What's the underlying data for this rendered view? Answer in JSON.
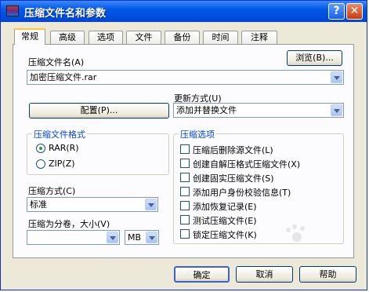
{
  "window": {
    "title": "压缩文件名和参数",
    "help_glyph": "?",
    "close_glyph": "✕"
  },
  "tabs": [
    "常规",
    "高级",
    "选项",
    "文件",
    "备份",
    "时间",
    "注释"
  ],
  "archive_name": {
    "label": "压缩文件名(A)",
    "value": "加密压缩文件.rar",
    "browse_button": "浏览(B)..."
  },
  "profiles_button": "配置(P)...",
  "update_mode": {
    "label": "更新方式(U)",
    "value": "添加并替换文件"
  },
  "format_group": {
    "title": "压缩文件格式",
    "options": [
      "RAR(R)",
      "ZIP(Z)"
    ],
    "selected": "RAR(R)"
  },
  "options_group": {
    "title": "压缩选项",
    "items": [
      {
        "label": "压缩后删除源文件(L)",
        "checked": false
      },
      {
        "label": "创建自解压格式压缩文件(X)",
        "checked": false
      },
      {
        "label": "创建固实压缩文件(S)",
        "checked": false
      },
      {
        "label": "添加用户身份校验信息(T)",
        "checked": false
      },
      {
        "label": "添加恢复记录(E)",
        "checked": false
      },
      {
        "label": "测试压缩文件(E)",
        "checked": false
      },
      {
        "label": "锁定压缩文件(K)",
        "checked": false
      }
    ]
  },
  "compression_method": {
    "label": "压缩方式(C)",
    "value": "标准"
  },
  "split_volumes": {
    "label": "压缩为分卷，大小(V)",
    "value": "",
    "unit": "MB"
  },
  "buttons": {
    "ok": "确定",
    "cancel": "取消",
    "help": "帮助"
  }
}
